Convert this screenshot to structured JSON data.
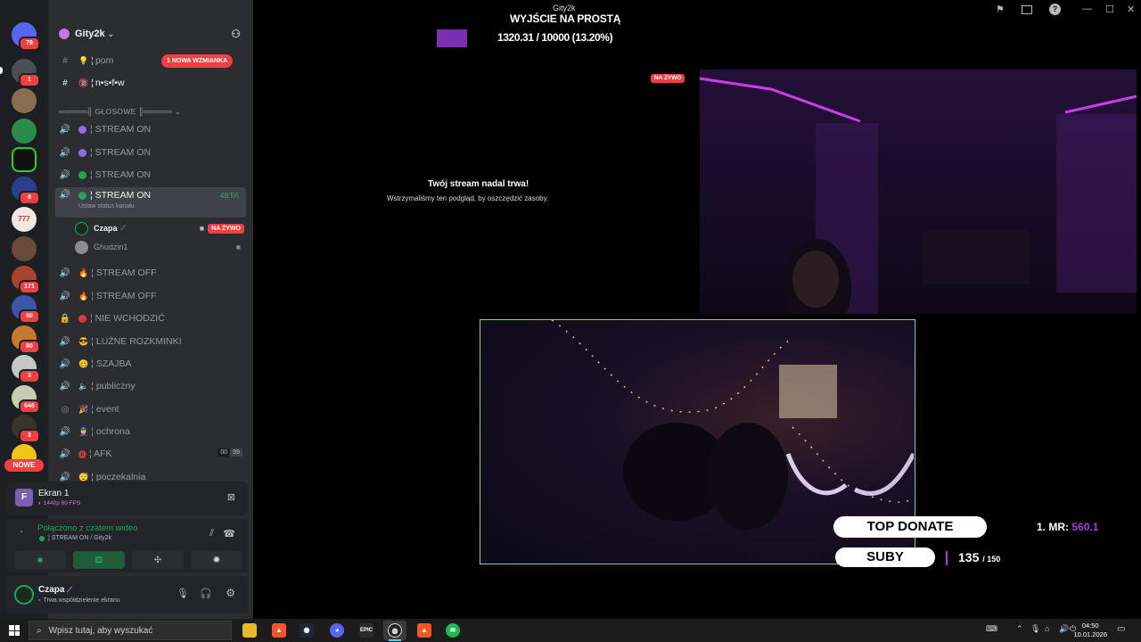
{
  "window": {
    "title": "Gity2k",
    "overlay_title": "WYJŚCIE NA PROSTĄ",
    "progress_text": "1320.31 / 10000 (13.20%)",
    "progress_fraction": 0.132
  },
  "rail": {
    "badges": [
      "79",
      "1",
      "8",
      "171",
      "50",
      "80",
      "3",
      "646",
      "3"
    ],
    "nowe_label": "NOWE",
    "server_777_label": "777"
  },
  "sidebar": {
    "guild_name": "Gity2k",
    "channels": [
      {
        "label": "pom",
        "emoji": "💡"
      },
      {
        "label": "n•s•f•w",
        "emoji": "🔞"
      }
    ],
    "mention_pill": "1 NOWA WZMIANKA",
    "voice_category": "═════╣ GŁOSOWE ╠═════",
    "voice_channels": [
      {
        "label": "¦ STREAM ON",
        "dot": "#8c6ee3"
      },
      {
        "label": "¦ STREAM ON",
        "dot": "#8c6ee3"
      },
      {
        "label": "¦ STREAM ON",
        "dot": "#23a55a"
      },
      {
        "label": "¦ STREAM ON",
        "dot": "#23a55a",
        "active": true,
        "timer": "48:56",
        "sub": "Ustaw status kanału"
      },
      {
        "label": "¦ STREAM OFF",
        "emoji": "🔥"
      },
      {
        "label": "¦ STREAM OFF",
        "emoji": "🔥"
      },
      {
        "label": "¦ NIE WCHODZIĆ",
        "dot": "#da373c"
      },
      {
        "label": "¦ LUŹNE ROZKMINKI",
        "emoji": "😎"
      },
      {
        "label": "¦ SZAJBA",
        "emoji": "🥴"
      },
      {
        "label": "¦ publiczny",
        "emoji": "🔈"
      },
      {
        "label": "¦ event",
        "emoji": "🎉"
      },
      {
        "label": "¦ ochrona",
        "emoji": "👮"
      },
      {
        "label": "¦ AFK",
        "emoji": "🅚",
        "count_a": "00",
        "count_b": "99"
      },
      {
        "label": "¦ poczekalnia",
        "emoji": "😴"
      }
    ],
    "members": [
      {
        "name": "Czapa",
        "live": "NA ŻYWO"
      },
      {
        "name": "Ghudzin1"
      }
    ]
  },
  "screen_panel": {
    "title": "Ekran 1",
    "quality": "1440p 60 FPS"
  },
  "voice_panel": {
    "status": "Połączono z czatem wideo",
    "channel": "¦ STREAM ON / Gity2k"
  },
  "user_panel": {
    "name": "Czapa",
    "status": "Trwa współdzielenie ekranu"
  },
  "stream": {
    "live_badge": "NA ŻYWO",
    "paused_title": "Twój stream nadal trwa!",
    "paused_sub": "Wstrzymaliśmy ten podgląd, by oszczędzić zasoby."
  },
  "overlay": {
    "top_donate_label": "TOP DONATE",
    "top_donate_value_prefix": "1. MR:",
    "top_donate_value": "560.1",
    "suby_label": "SUBY",
    "suby_value": "135",
    "suby_total": "/ 150"
  },
  "taskbar": {
    "search_placeholder": "Wpisz tutaj, aby wyszukać",
    "time": "04:50",
    "date": "10.01.2026"
  },
  "colors": {
    "accent_live": "#f23f43",
    "progress": "#7b2fb0",
    "connected": "#23a55a"
  }
}
